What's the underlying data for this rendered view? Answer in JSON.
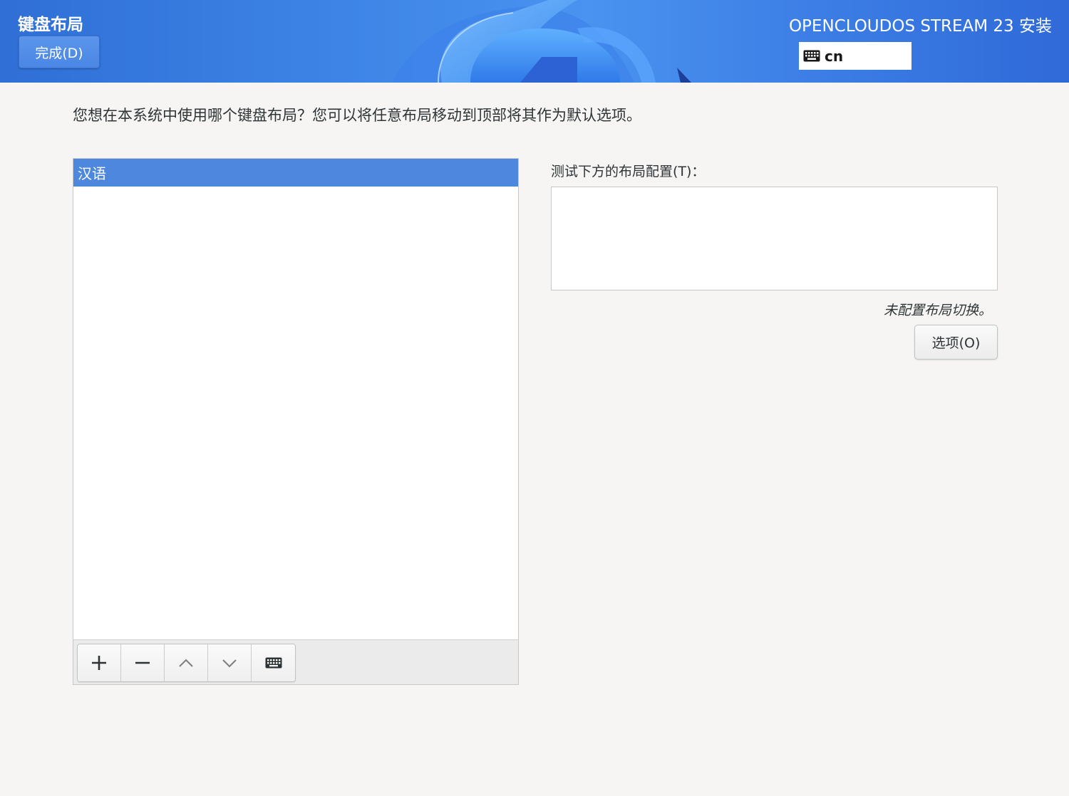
{
  "header": {
    "page_title": "键盘布局",
    "done_label": "完成(D)",
    "product_title": "OPENCLOUDOS STREAM 23 安装",
    "keyboard_indicator": {
      "icon": "keyboard-icon",
      "value": "cn"
    },
    "accent_color": "#3f86e8"
  },
  "main": {
    "question": "您想在本系统中使用哪个键盘布局？您可以将任意布局移动到顶部将其作为默认选项。",
    "layouts": [
      {
        "label": "汉语",
        "selected": true
      }
    ],
    "toolbar": {
      "buttons": [
        {
          "icon": "plus-icon",
          "action": "add"
        },
        {
          "icon": "minus-icon",
          "action": "remove"
        },
        {
          "icon": "chevron-up-icon",
          "action": "move-up"
        },
        {
          "icon": "chevron-down-icon",
          "action": "move-down"
        },
        {
          "icon": "keyboard-icon",
          "action": "preview"
        }
      ]
    },
    "test_label": "测试下方的布局配置(T)：",
    "test_value": "",
    "switch_note": "未配置布局切换。",
    "options_label": "选项(O)",
    "selection_color": "#4e88de"
  }
}
